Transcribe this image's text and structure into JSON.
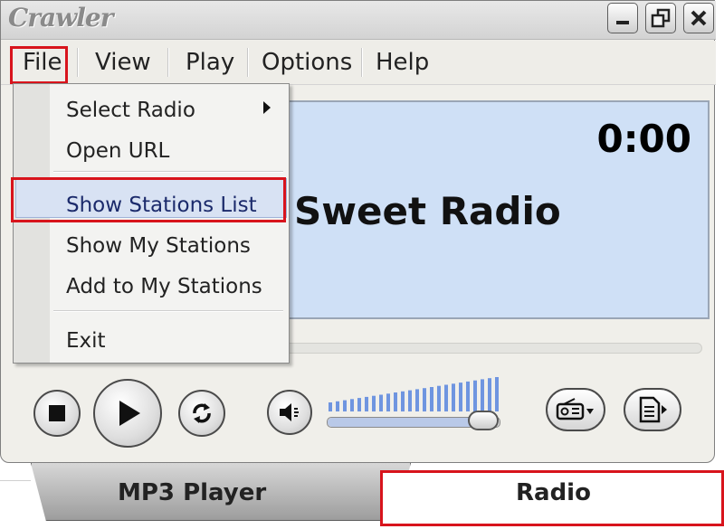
{
  "app": {
    "logo_text": "Crawler"
  },
  "window_controls": {
    "minimize_icon": "minimize-icon",
    "restore_icon": "restore-icon",
    "close_icon": "close-icon"
  },
  "menubar": {
    "items": [
      {
        "label": "File"
      },
      {
        "label": "View"
      },
      {
        "label": "Play"
      },
      {
        "label": "Options"
      },
      {
        "label": "Help"
      }
    ]
  },
  "file_menu": {
    "items": [
      {
        "label": "Select Radio",
        "has_submenu": true
      },
      {
        "label": "Open URL"
      },
      {
        "label": "Show Stations List",
        "highlighted": true
      },
      {
        "label": "Show My Stations"
      },
      {
        "label": "Add to My Stations"
      },
      {
        "label": "Exit"
      }
    ]
  },
  "display": {
    "time": "0:00",
    "station_name": "Sweet Radio"
  },
  "playback": {
    "progress_fraction": 0.0,
    "controls": [
      "stop-icon",
      "play-icon",
      "repeat-icon",
      "volume-icon",
      "radio-dropdown-icon",
      "playlist-icon"
    ]
  },
  "volume": {
    "level_fraction": 0.93
  },
  "tabs": [
    {
      "label": "MP3 Player",
      "active": false
    },
    {
      "label": "Radio",
      "active": true
    }
  ],
  "colors": {
    "highlight_box": "#d8141c",
    "display_bg": "#cfe0f6",
    "menu_hover": "#d8e2f3"
  }
}
